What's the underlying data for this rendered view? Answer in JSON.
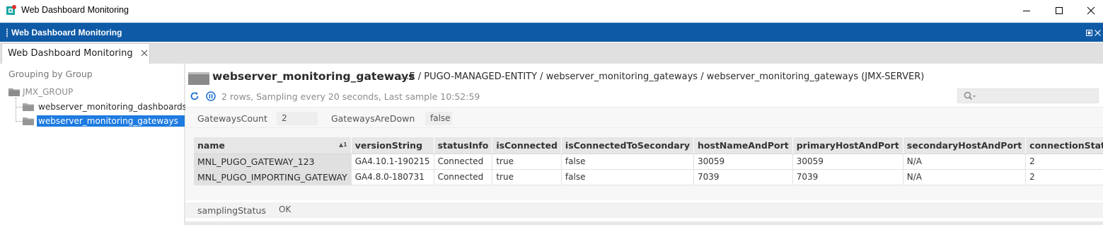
{
  "window": {
    "title": "Web Dashboard Monitoring"
  },
  "panel": {
    "title": "Web Dashboard Monitoring"
  },
  "tab": {
    "label": "Web Dashboard Monitoring"
  },
  "sidebar": {
    "heading": "Grouping by Group",
    "root": "JMX_GROUP",
    "items": [
      {
        "label": "webserver_monitoring_dashboards",
        "selected": false
      },
      {
        "label": "webserver_monitoring_gateways",
        "selected": true
      }
    ]
  },
  "header": {
    "title": "webserver_monitoring_gateways",
    "path": "...E / PUGO-MANAGED-ENTITY / webserver_monitoring_gateways / webserver_monitoring_gateways (JMX-SERVER)",
    "status": "2 rows, Sampling every 20 seconds, Last sample 10:52:59"
  },
  "properties": {
    "gateways_count_label": "GatewaysCount",
    "gateways_count_value": "2",
    "gateways_down_label": "GatewaysAreDown",
    "gateways_down_value": "false"
  },
  "table": {
    "sort_indicator": "▲1",
    "columns": [
      "name",
      "versionString",
      "statusInfo",
      "isConnected",
      "isConnectedToSecondary",
      "hostNameAndPort",
      "primaryHostAndPort",
      "secondaryHostAndPort",
      "connectionState"
    ],
    "rows": [
      [
        "MNL_PUGO_GATEWAY_123",
        "GA4.10.1-190215",
        "Connected",
        "true",
        "false",
        "30059",
        "30059",
        "N/A",
        "2"
      ],
      [
        "MNL_PUGO_IMPORTING_GATEWAY",
        "GA4.8.0-180731",
        "Connected",
        "true",
        "false",
        "7039",
        "7039",
        "N/A",
        "2"
      ]
    ]
  },
  "sampling": {
    "label": "samplingStatus",
    "value": "OK"
  },
  "colors": {
    "panel_bar": "#0f5aa6",
    "selection": "#1e7be0",
    "accent_icon": "#1e6fd0"
  }
}
